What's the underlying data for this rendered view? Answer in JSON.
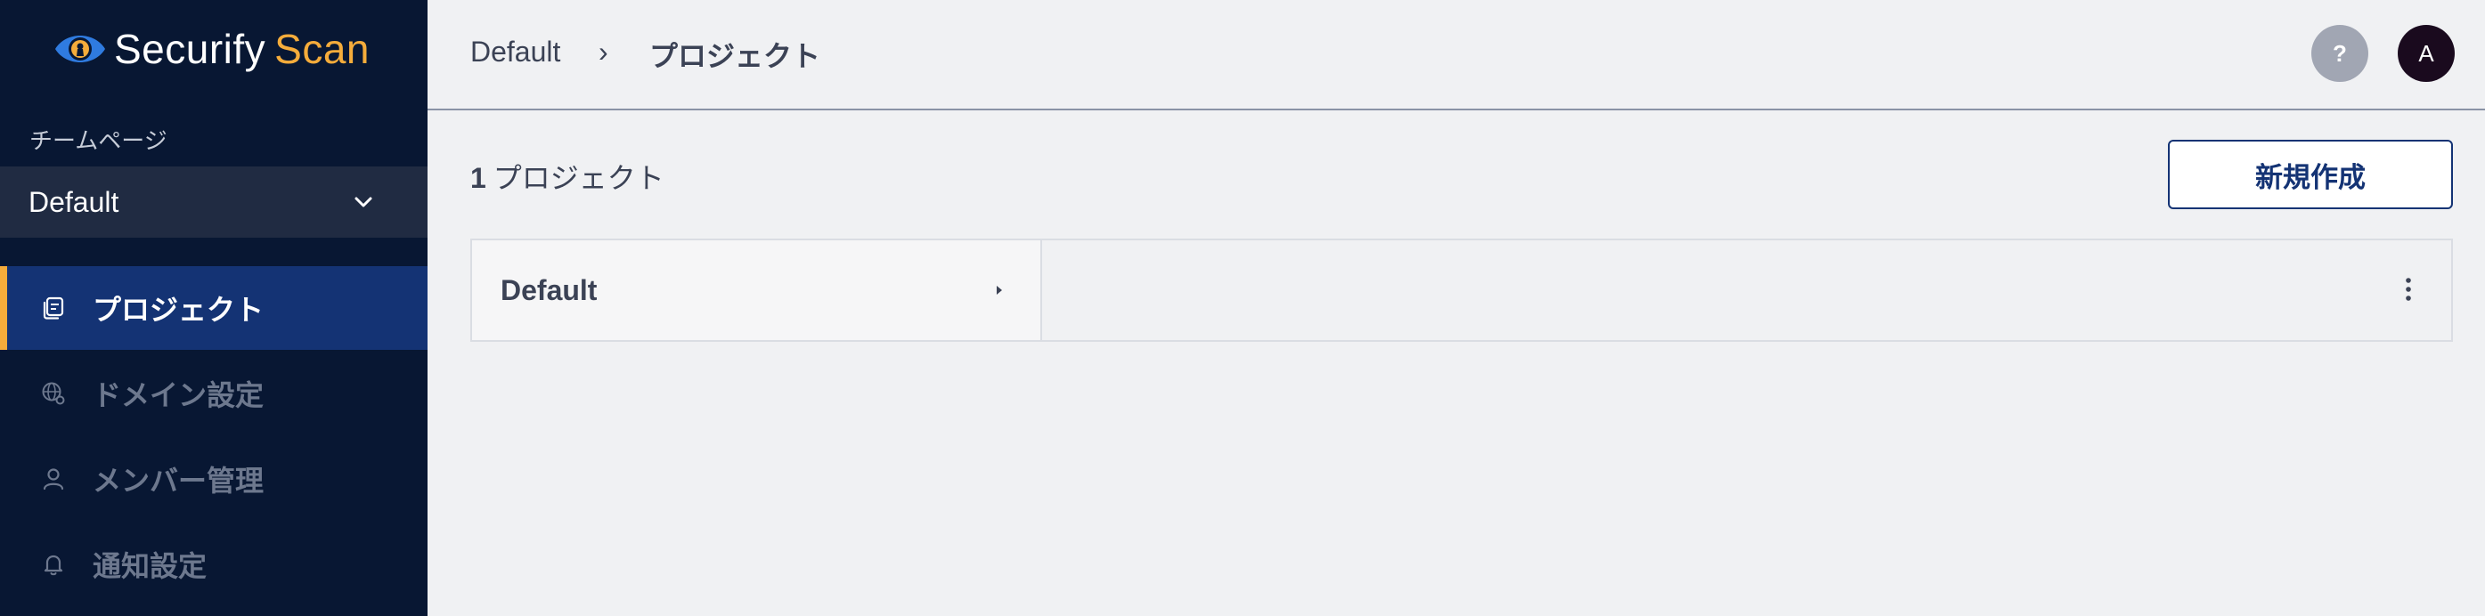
{
  "brand": {
    "name_main": "Securify",
    "name_accent": "Scan",
    "accent_color": "#f5ac3b"
  },
  "sidebar": {
    "team_label": "チームページ",
    "team_select": {
      "value": "Default"
    },
    "items": [
      {
        "label": "プロジェクト",
        "icon": "projects-icon",
        "active": true
      },
      {
        "label": "ドメイン設定",
        "icon": "globe-settings-icon",
        "active": false
      },
      {
        "label": "メンバー管理",
        "icon": "user-icon",
        "active": false
      },
      {
        "label": "通知設定",
        "icon": "bell-icon",
        "active": false
      }
    ]
  },
  "header": {
    "breadcrumb": {
      "root": "Default",
      "separator": "›",
      "current": "プロジェクト"
    },
    "help_label": "?",
    "avatar_initial": "A"
  },
  "main": {
    "count_number": "1",
    "count_label": "プロジェクト",
    "new_button_label": "新規作成",
    "projects": [
      {
        "name": "Default"
      }
    ]
  },
  "colors": {
    "sidebar_bg": "#081733",
    "active_bg": "#143374",
    "page_bg": "#f0f1f3"
  }
}
